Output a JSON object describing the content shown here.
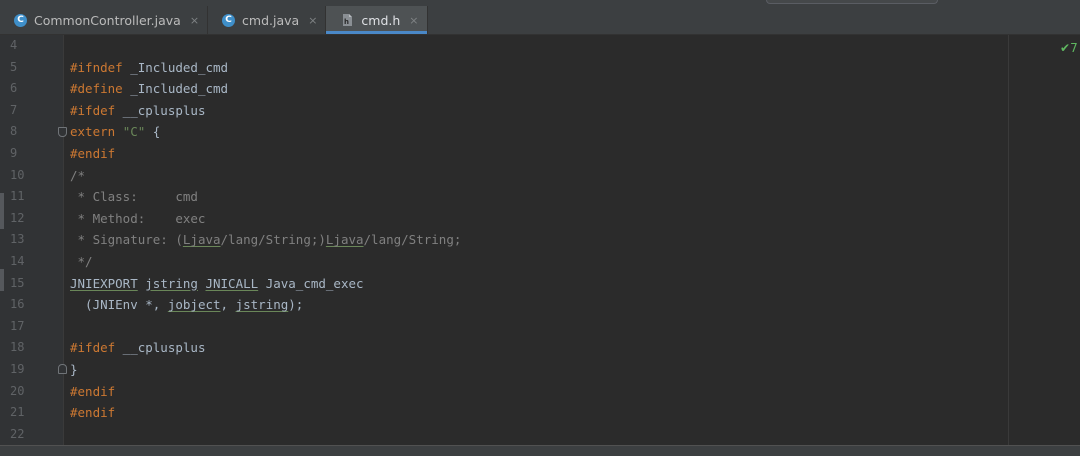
{
  "tabs": [
    {
      "label": "CommonController.java",
      "icon": "java-class-icon",
      "glyph": "C",
      "close": "×"
    },
    {
      "label": "cmd.java",
      "icon": "java-class-icon",
      "glyph": "C",
      "close": "×"
    },
    {
      "label": "cmd.h",
      "icon": "c-header-file-icon",
      "close": "×",
      "active": true
    }
  ],
  "editor": {
    "line_numbers": [
      "4",
      "5",
      "6",
      "7",
      "8",
      "9",
      "10",
      "11",
      "12",
      "13",
      "14",
      "15",
      "16",
      "17",
      "18",
      "19",
      "20",
      "21",
      "22"
    ],
    "inspection": "7",
    "lines": [
      "",
      "#ifndef _Included_cmd",
      "#define _Included_cmd",
      "#ifdef __cplusplus",
      "extern \"C\" {",
      "#endif",
      "/*",
      " * Class:     cmd",
      " * Method:    exec",
      " * Signature: (Ljava/lang/String;)Ljava/lang/String;",
      " */",
      "JNIEXPORT jstring JNICALL Java_cmd_exec",
      "  (JNIEnv *, jobject, jstring);",
      "",
      "#ifdef __cplusplus",
      "}",
      "#endif",
      "#endif",
      ""
    ]
  },
  "colors": {
    "keyword": "#cc7832",
    "string": "#6a8759",
    "comment": "#808080",
    "text": "#a9b7c6",
    "accent": "#4a88c7"
  }
}
